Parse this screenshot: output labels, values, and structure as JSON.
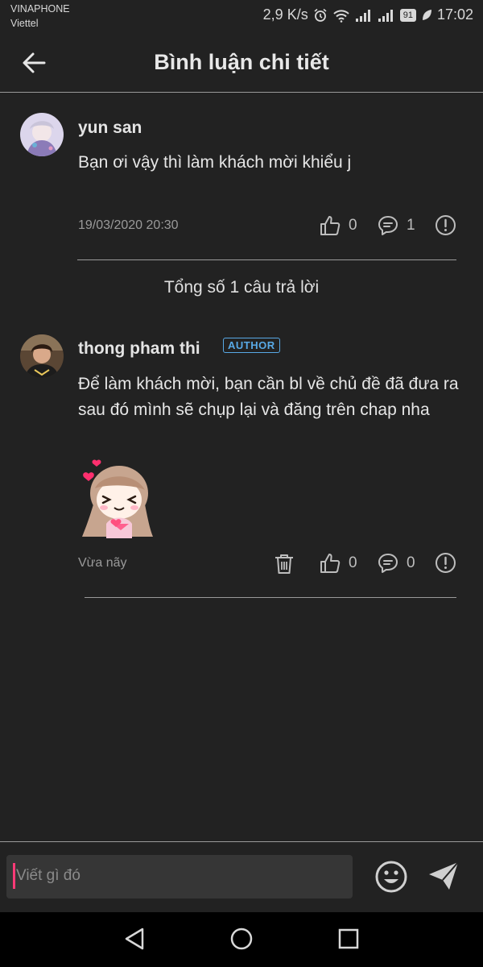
{
  "status": {
    "carrier1": "VINAPHONE",
    "carrier2": "Viettel",
    "speed": "2,9 K/s",
    "battery": "91",
    "time": "17:02"
  },
  "header": {
    "title": "Bình luận chi tiết",
    "back_icon": "arrow-left-icon"
  },
  "comment": {
    "author": "yun san",
    "text": "Bạn ơi vậy thì làm khách mời khiểu j",
    "time": "19/03/2020 20:30",
    "likes": "0",
    "replies": "1"
  },
  "replies_summary": "Tổng số 1 câu trả lời",
  "reply": {
    "author": "thong pham thi",
    "badge": "AUTHOR",
    "text": "Để làm khách mời, bạn cần bl về chủ đề đã đưa ra sau đó mình sẽ chụp lại và đăng trên chap nha",
    "time": "Vừa nãy",
    "likes": "0",
    "replies": "0"
  },
  "composer": {
    "placeholder": "Viết gì đó"
  },
  "colors": {
    "background": "#222222",
    "accent_badge": "#58a9e6",
    "caret": "#ff3a77"
  }
}
